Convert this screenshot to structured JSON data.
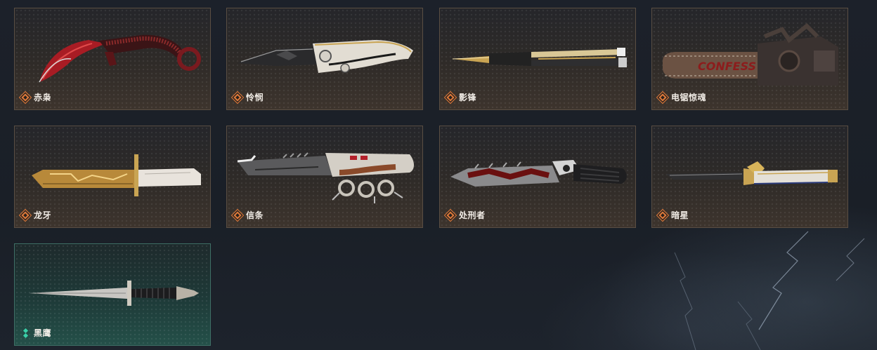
{
  "items": [
    {
      "name": "赤枭",
      "rarity": "orange",
      "icon": "karambit-knife-icon",
      "accent": "#b3202a"
    },
    {
      "name": "怜悯",
      "rarity": "orange",
      "icon": "folding-knife-icon",
      "accent": "#d8d4cc"
    },
    {
      "name": "影锋",
      "rarity": "orange",
      "icon": "butterfly-knife-icon",
      "accent": "#c9a453"
    },
    {
      "name": "电锯惊魂",
      "rarity": "orange",
      "icon": "chainsaw-icon",
      "accent": "#7a5a45"
    },
    {
      "name": "龙牙",
      "rarity": "orange",
      "icon": "bayonet-knife-icon",
      "accent": "#c79a3a"
    },
    {
      "name": "信条",
      "rarity": "orange",
      "icon": "knuckle-knife-icon",
      "accent": "#cfcac2"
    },
    {
      "name": "处刑者",
      "rarity": "orange",
      "icon": "executioner-knife-icon",
      "accent": "#8c1c1c"
    },
    {
      "name": "暗星",
      "rarity": "orange",
      "icon": "stiletto-knife-icon",
      "accent": "#c9a453"
    },
    {
      "name": "黑鹰",
      "rarity": "teal",
      "icon": "combat-dagger-icon",
      "accent": "#bdbdbd"
    }
  ],
  "colors": {
    "background": "#1b2029",
    "orange_rarity": "#e07a3a",
    "teal_rarity": "#3ad0a8",
    "orange_border": "#5a4e43",
    "teal_border": "#3f6f66"
  }
}
